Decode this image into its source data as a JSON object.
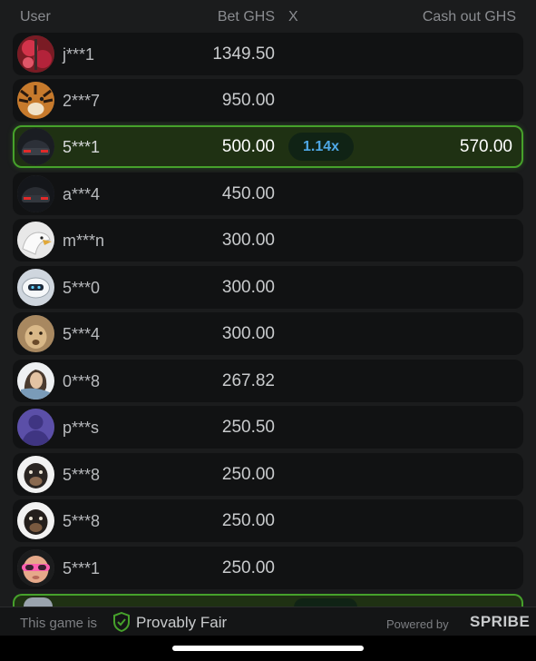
{
  "header": {
    "user": "User",
    "bet": "Bet GHS",
    "x": "X",
    "cashout": "Cash out GHS"
  },
  "rows": [
    {
      "user": "j***1",
      "bet": "1349.50",
      "avatar": "red-flowers-avatar-icon"
    },
    {
      "user": "2***7",
      "bet": "950.00",
      "avatar": "tiger-avatar-icon"
    },
    {
      "user": "5***1",
      "bet": "500.00",
      "multiplier": "1.14x",
      "cashout": "570.00",
      "avatar": "car-avatar-icon"
    },
    {
      "user": "a***4",
      "bet": "450.00",
      "avatar": "car-avatar-icon"
    },
    {
      "user": "m***n",
      "bet": "300.00",
      "avatar": "eagle-avatar-icon"
    },
    {
      "user": "5***0",
      "bet": "300.00",
      "avatar": "robot-avatar-icon"
    },
    {
      "user": "5***4",
      "bet": "300.00",
      "avatar": "lioness-avatar-icon"
    },
    {
      "user": "0***8",
      "bet": "267.82",
      "avatar": "portrait-avatar-icon"
    },
    {
      "user": "p***s",
      "bet": "250.50",
      "avatar": "person-silhouette-avatar-icon"
    },
    {
      "user": "5***8",
      "bet": "250.00",
      "avatar": "dog-avatar-icon"
    },
    {
      "user": "5***8",
      "bet": "250.00",
      "avatar": "dog-avatar-icon"
    },
    {
      "user": "5***1",
      "bet": "250.00",
      "avatar": "baby-sunglasses-avatar-icon"
    }
  ],
  "footer": {
    "left": "This game is",
    "fair": "Provably Fair",
    "powered": "Powered by",
    "brand": "SPRIBE"
  },
  "colors": {
    "win_border": "#46a12b",
    "win_bg": "#1f3113",
    "multiplier_text": "#4fa8e6"
  }
}
